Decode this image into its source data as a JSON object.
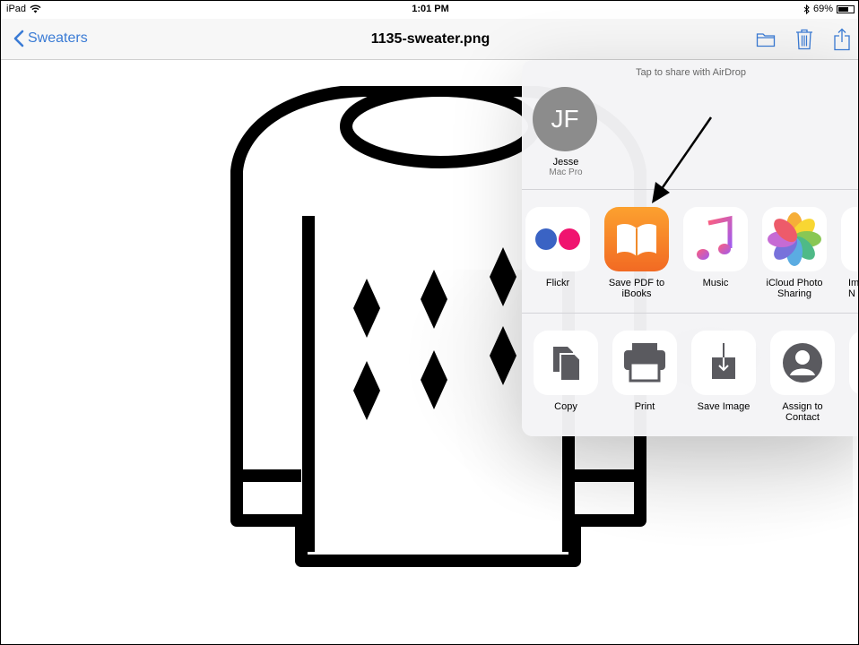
{
  "status": {
    "device": "iPad",
    "time": "1:01 PM",
    "battery": "69%",
    "battery_level": 0.69
  },
  "nav": {
    "back_label": "Sweaters",
    "title": "1135-sweater.png"
  },
  "share": {
    "airdrop_hint": "Tap to share with AirDrop",
    "contact": {
      "initials": "JF",
      "name": "Jesse",
      "device": "Mac Pro"
    },
    "apps": [
      {
        "label": "Flickr"
      },
      {
        "label": "Save PDF to\niBooks"
      },
      {
        "label": "Music"
      },
      {
        "label": "iCloud Photo\nSharing"
      },
      {
        "label": "Im\nN"
      }
    ],
    "actions": [
      {
        "label": "Copy"
      },
      {
        "label": "Print"
      },
      {
        "label": "Save Image"
      },
      {
        "label": "Assign to\nContact"
      }
    ]
  },
  "colors": {
    "accent": "#3a7bd5",
    "ibooks_top": "#fca12f",
    "ibooks_bottom": "#f26a23",
    "flickr_blue": "#3a63c4",
    "flickr_pink": "#f0146f"
  }
}
